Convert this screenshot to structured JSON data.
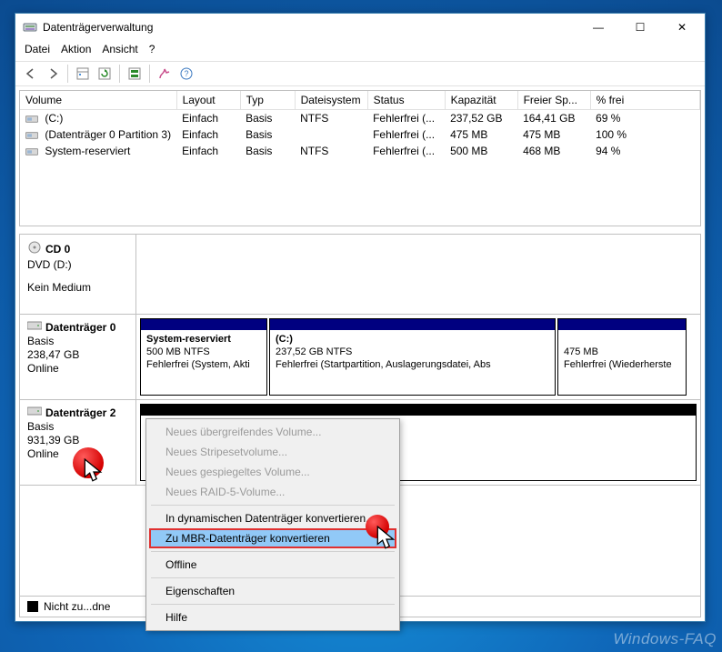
{
  "window": {
    "title": "Datenträgerverwaltung",
    "minimize_glyph": "—",
    "maximize_glyph": "☐",
    "close_glyph": "✕"
  },
  "menu": {
    "file": "Datei",
    "action": "Aktion",
    "view": "Ansicht",
    "help": "?"
  },
  "table": {
    "headers": {
      "volume": "Volume",
      "layout": "Layout",
      "typ": "Typ",
      "fs": "Dateisystem",
      "status": "Status",
      "capacity": "Kapazität",
      "free": "Freier Sp...",
      "pct": "% frei"
    },
    "rows": [
      {
        "volume": "(C:)",
        "layout": "Einfach",
        "typ": "Basis",
        "fs": "NTFS",
        "status": "Fehlerfrei (...",
        "capacity": "237,52 GB",
        "free": "164,41 GB",
        "pct": "69 %"
      },
      {
        "volume": "(Datenträger 0 Partition 3)",
        "layout": "Einfach",
        "typ": "Basis",
        "fs": "",
        "status": "Fehlerfrei (...",
        "capacity": "475 MB",
        "free": "475 MB",
        "pct": "100 %"
      },
      {
        "volume": "System-reserviert",
        "layout": "Einfach",
        "typ": "Basis",
        "fs": "NTFS",
        "status": "Fehlerfrei (...",
        "capacity": "500 MB",
        "free": "468 MB",
        "pct": "94 %"
      }
    ]
  },
  "disks": {
    "cd": {
      "name": "CD 0",
      "line2": "DVD (D:)",
      "line3": "Kein Medium"
    },
    "d0": {
      "name": "Datenträger 0",
      "type": "Basis",
      "size": "238,47 GB",
      "state": "Online",
      "parts": [
        {
          "title": "System-reserviert",
          "line2": "500 MB NTFS",
          "line3": "Fehlerfrei (System, Akti"
        },
        {
          "title": "(C:)",
          "line2": "237,52 GB NTFS",
          "line3": "Fehlerfrei (Startpartition, Auslagerungsdatei, Abs"
        },
        {
          "title": "",
          "line2": "475 MB",
          "line3": "Fehlerfrei (Wiederherste"
        }
      ]
    },
    "d2": {
      "name": "Datenträger 2",
      "type": "Basis",
      "size": "931,39 GB",
      "state": "Online"
    }
  },
  "legend": {
    "unallocated": "Nicht zu...dne"
  },
  "context_menu": {
    "items": [
      {
        "key": "span",
        "label": "Neues übergreifendes Volume...",
        "enabled": false
      },
      {
        "key": "stripe",
        "label": "Neues Stripesetvolume...",
        "enabled": false
      },
      {
        "key": "mirror",
        "label": "Neues gespiegeltes Volume...",
        "enabled": false
      },
      {
        "key": "raid5",
        "label": "Neues RAID-5-Volume...",
        "enabled": false
      }
    ],
    "sep1": true,
    "convert_dyn": "In dynamischen Datenträger konvertieren...",
    "convert_mbr": "Zu MBR-Datenträger konvertieren",
    "sep2": true,
    "offline": "Offline",
    "sep3": true,
    "properties": "Eigenschaften",
    "sep4": true,
    "help": "Hilfe"
  },
  "watermark": "Windows-FAQ"
}
